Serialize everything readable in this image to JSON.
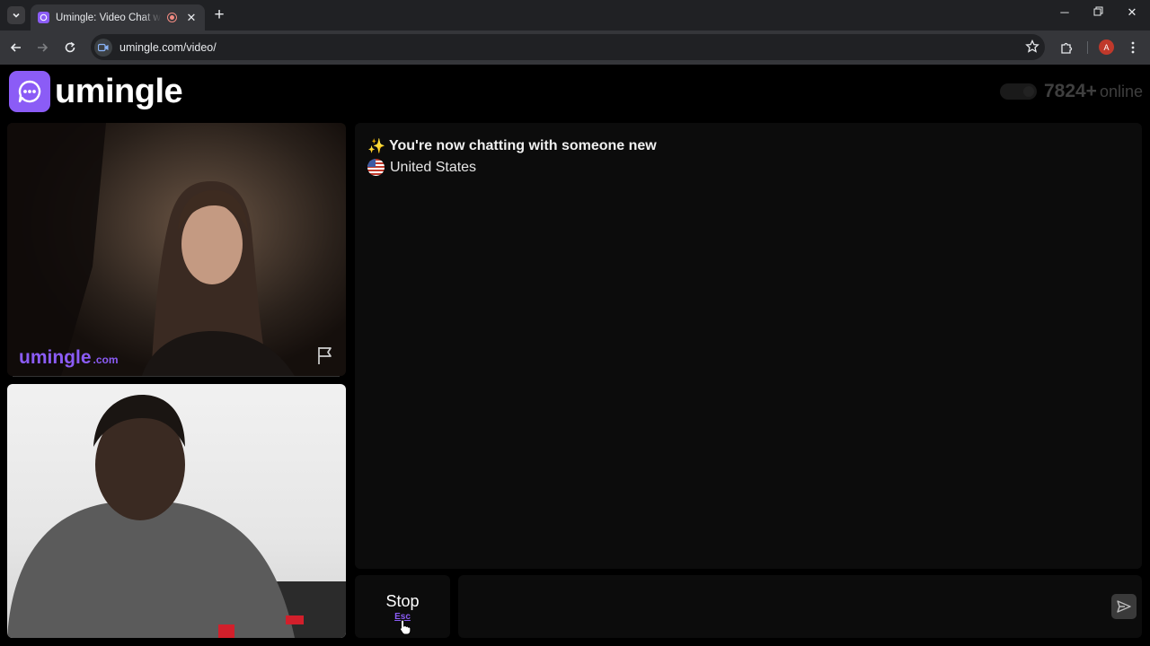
{
  "browser": {
    "tab_title": "Umingle: Video Chat with Strangers",
    "new_tab_label": "+",
    "url": "umingle.com/video/",
    "profile_initial": "A"
  },
  "header": {
    "logo_text": "umingle",
    "online_count": "7824+",
    "online_label": "online"
  },
  "remote_video": {
    "watermark": "umingle",
    "watermark_domain": ".com"
  },
  "chat": {
    "system_message": "You're now chatting with someone new",
    "country": "United States",
    "sparkle": "✨"
  },
  "controls": {
    "stop_label": "Stop",
    "stop_shortcut": "Esc",
    "input_placeholder": ""
  },
  "colors": {
    "brand": "#8b5cf6",
    "background": "#000000",
    "panel": "#0c0c0c"
  }
}
